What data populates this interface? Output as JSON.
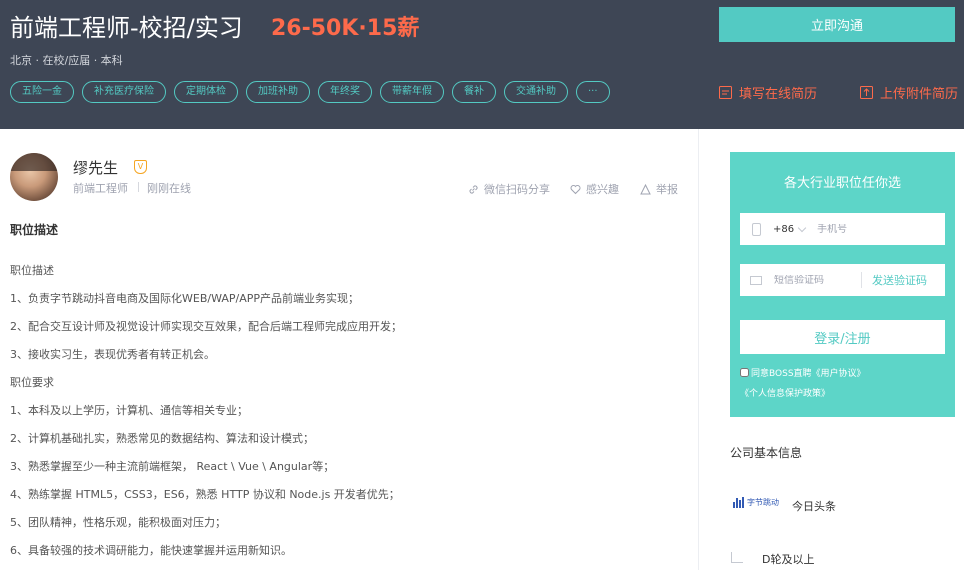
{
  "job": {
    "title": "前端工程师-校招/实习",
    "salary": "26-50K·15薪",
    "meta": "北京 · 在校/应届 · 本科",
    "tags": [
      "五险一金",
      "补充医疗保险",
      "定期体检",
      "加班补助",
      "年终奖",
      "带薪年假",
      "餐补",
      "交通补助",
      "···"
    ]
  },
  "actions": {
    "chat_label": "立即沟通",
    "fill_resume_label": "填写在线简历",
    "upload_resume_label": "上传附件简历"
  },
  "recruiter": {
    "name": "缪先生",
    "badge": "V",
    "title": "前端工程师",
    "status": "刚刚在线",
    "share_label": "微信扫码分享",
    "interest_label": "感兴趣",
    "report_label": "举报"
  },
  "description": {
    "section_title": "职位描述",
    "lines": [
      "职位描述",
      "1、负责字节跳动抖音电商及国际化WEB/WAP/APP产品前端业务实现；",
      "2、配合交互设计师及视觉设计师实现交互效果，配合后端工程师完成应用开发；",
      "3、接收实习生，表现优秀者有转正机会。",
      "职位要求",
      "1、本科及以上学历，计算机、通信等相关专业；",
      "2、计算机基础扎实，熟悉常见的数据结构、算法和设计模式；",
      "3、熟悉掌握至少一种主流前端框架， React \\ Vue \\ Angular等；",
      "4、熟练掌握 HTML5，CSS3，ES6，熟悉 HTTP 协议和 Node.js 开发者优先；",
      "5、团队精神，性格乐观，能积极面对压力；",
      "6、具备较强的技术调研能力，能快速掌握并运用新知识。"
    ]
  },
  "login": {
    "title": "各大行业职位任你选",
    "country_code": "+86",
    "phone_placeholder": "手机号",
    "code_placeholder": "短信验证码",
    "send_code_label": "发送验证码",
    "submit_label": "登录/注册",
    "agree_prefix": "同意BOSS直聘",
    "agree_link1": "《用户协议》",
    "agree_link2": "《个人信息保护政策》"
  },
  "company": {
    "section_title": "公司基本信息",
    "logo_text": "字节跳动",
    "name": "今日头条",
    "funding": "D轮及以上"
  },
  "colors": {
    "header_bg": "#3e4655",
    "accent": "#53cac3",
    "salary": "#fd6a4b",
    "login_bg": "#5dd5c8"
  }
}
